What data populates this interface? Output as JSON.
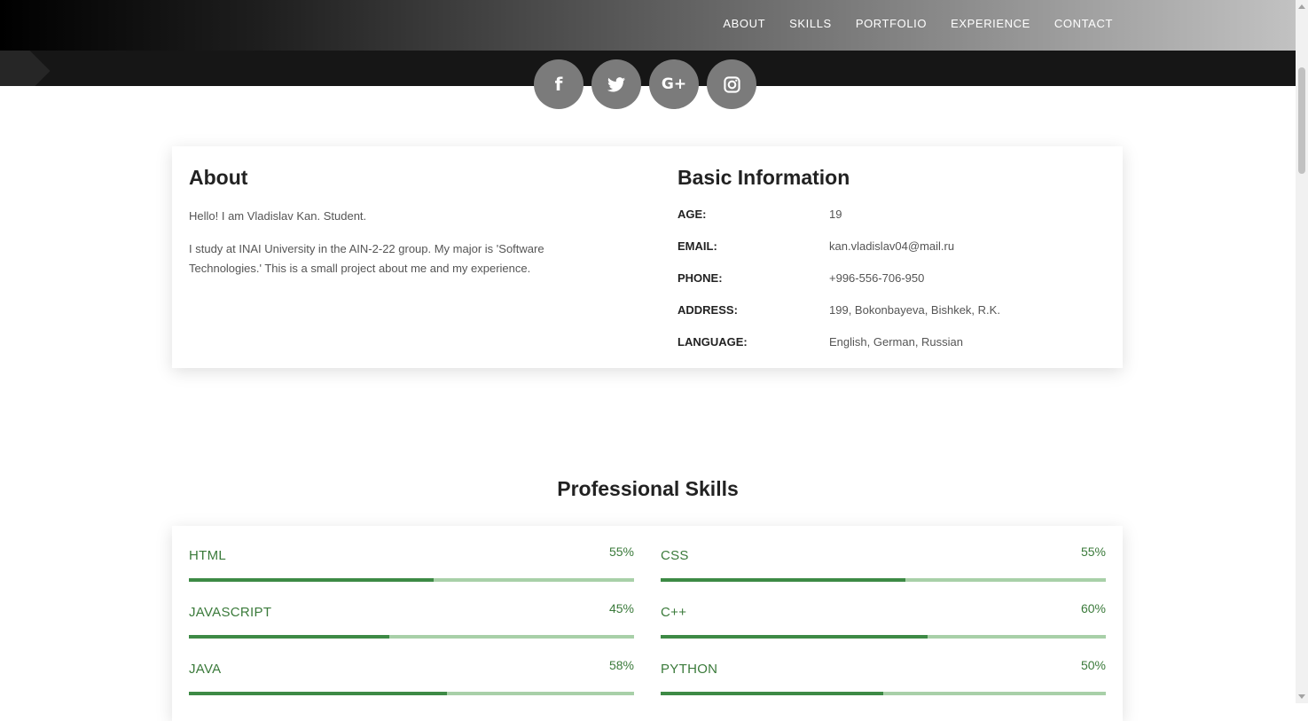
{
  "nav": {
    "items": [
      "ABOUT",
      "SKILLS",
      "PORTFOLIO",
      "EXPERIENCE",
      "CONTACT"
    ]
  },
  "socials": [
    {
      "icon": "facebook-icon",
      "label": "f"
    },
    {
      "icon": "twitter-icon"
    },
    {
      "icon": "google-plus-icon",
      "label": "G+"
    },
    {
      "icon": "instagram-icon"
    }
  ],
  "about": {
    "title": "About",
    "paragraphs": [
      "Hello! I am Vladislav Kan. Student.",
      "I study at INAI University in the AIN-2-22 group. My major is 'Software Technologies.' This is a small project about me and my experience."
    ]
  },
  "info": {
    "title": "Basic Information",
    "rows": [
      {
        "label": "AGE:",
        "value": "19"
      },
      {
        "label": "EMAIL:",
        "value": "kan.vladislav04@mail.ru"
      },
      {
        "label": "PHONE:",
        "value": "+996-556-706-950"
      },
      {
        "label": "ADDRESS:",
        "value": "199, Bokonbayeva, Bishkek, R.K."
      },
      {
        "label": "LANGUAGE:",
        "value": "English, German, Russian"
      }
    ]
  },
  "skills": {
    "title": "Professional Skills",
    "items": [
      {
        "name": "HTML",
        "pct_label": "55%",
        "level": 0.55
      },
      {
        "name": "CSS",
        "pct_label": "55%",
        "level": 0.55
      },
      {
        "name": "JAVASCRIPT",
        "pct_label": "45%",
        "level": 0.45
      },
      {
        "name": "C++",
        "pct_label": "60%",
        "level": 0.6
      },
      {
        "name": "JAVA",
        "pct_label": "58%",
        "level": 0.58
      },
      {
        "name": "PYTHON",
        "pct_label": "50%",
        "level": 0.5
      }
    ]
  },
  "colors": {
    "accent": "#3d8a45",
    "bar_track": "#a8d0a8",
    "social_bg": "#7b7b7b"
  }
}
